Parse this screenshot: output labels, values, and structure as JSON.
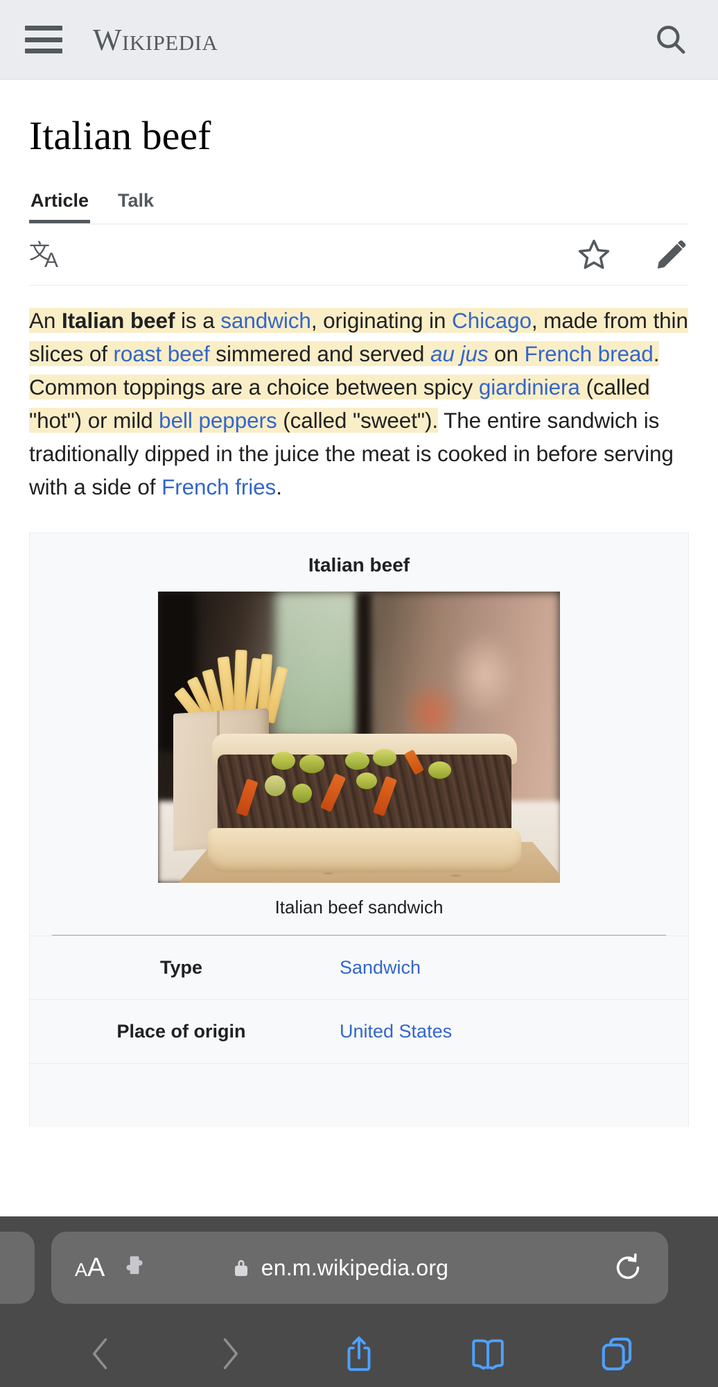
{
  "header": {
    "menu_label": "Menu",
    "wordmark": "Wikipedia",
    "search_label": "Search"
  },
  "article": {
    "title": "Italian beef",
    "tabs": [
      {
        "label": "Article",
        "active": true
      },
      {
        "label": "Talk",
        "active": false
      }
    ],
    "actions": {
      "language": "文A",
      "watch": "Watch",
      "edit": "Edit"
    },
    "lead": {
      "t1": "An ",
      "bold": "Italian beef",
      "t2": " is a ",
      "link1": "sandwich",
      "t3": ", originating in ",
      "link2": "Chicago",
      "t4": ", made from thin slices of ",
      "link3": "roast beef",
      "t5": " simmered and served ",
      "link4_italic": "au jus",
      "t6": " on ",
      "link5": "French bread",
      "t7": ". Common toppings are a choice between spicy ",
      "link6": "giardiniera",
      "t8": " (called \"hot\") or mild ",
      "link7": "bell peppers",
      "t9": " (called \"sweet\").",
      "t10": " The entire sandwich is traditionally dipped in the juice the meat is cooked in before serving with a side of ",
      "link8": "French fries",
      "t11": "."
    }
  },
  "infobox": {
    "title": "Italian beef",
    "image_alt": "Italian beef sandwich with French fries in a paper bag on kraft paper",
    "caption": "Italian beef sandwich",
    "rows": [
      {
        "key": "Type",
        "value": "Sandwich"
      },
      {
        "key": "Place of origin",
        "value": "United States"
      }
    ]
  },
  "browser": {
    "text_size_small": "A",
    "text_size_big": "A",
    "extensions_label": "Extensions",
    "secure_label": "Secure",
    "url": "en.m.wikipedia.org",
    "reload_label": "Reload",
    "nav": [
      {
        "name": "back",
        "enabled": false
      },
      {
        "name": "forward",
        "enabled": false
      },
      {
        "name": "share",
        "enabled": true
      },
      {
        "name": "bookmarks",
        "enabled": true
      },
      {
        "name": "tabs",
        "enabled": true
      }
    ]
  },
  "colors": {
    "chrome_bg": "#eaecf0",
    "link": "#3366cc",
    "highlight": "#faeec7",
    "infobox_bg": "#f8f9fa",
    "safari_bg": "#4a4a4a",
    "safari_accent": "#4ea1ff"
  }
}
